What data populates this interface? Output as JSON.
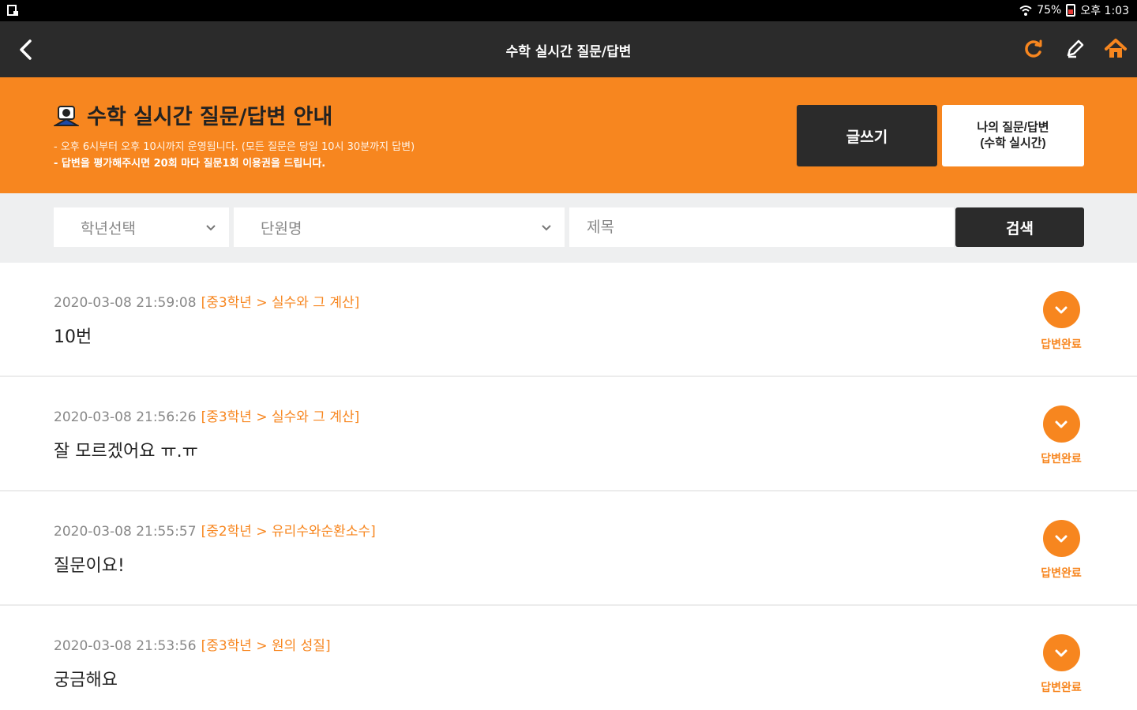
{
  "status_bar": {
    "battery": "75%",
    "time": "오후 1:03"
  },
  "header": {
    "title": "수학 실시간 질문/답변"
  },
  "banner": {
    "title": "수학 실시간 질문/답변 안내",
    "desc_line1": "- 오후 6시부터 오후 10시까지 운영됩니다. (모든 질문은 당일 10시 30분까지 답변)",
    "desc_line2": "- 답변을 평가해주시면 20회 마다 질문1회 이용권을 드립니다.",
    "write_button": "글쓰기",
    "my_button_line1": "나의 질문/답변",
    "my_button_line2": "(수학 실시간)"
  },
  "search": {
    "grade_select": "학년선택",
    "unit_select": "단원명",
    "title_placeholder": "제목",
    "search_button": "검색"
  },
  "questions": [
    {
      "datetime": "2020-03-08 21:59:08",
      "category": "[중3학년 > 실수와 그 계산]",
      "title": "10번",
      "status": "답변완료"
    },
    {
      "datetime": "2020-03-08 21:56:26",
      "category": "[중3학년 > 실수와 그 계산]",
      "title": "잘 모르겠어요 ㅠ.ㅠ",
      "status": "답변완료"
    },
    {
      "datetime": "2020-03-08 21:55:57",
      "category": "[중2학년 > 유리수와순환소수]",
      "title": "질문이요!",
      "status": "답변완료"
    },
    {
      "datetime": "2020-03-08 21:53:56",
      "category": "[중3학년 > 원의 성질]",
      "title": "궁금해요",
      "status": "답변완료"
    }
  ],
  "colors": {
    "accent": "#f7861f",
    "dark": "#2b2b2b"
  }
}
